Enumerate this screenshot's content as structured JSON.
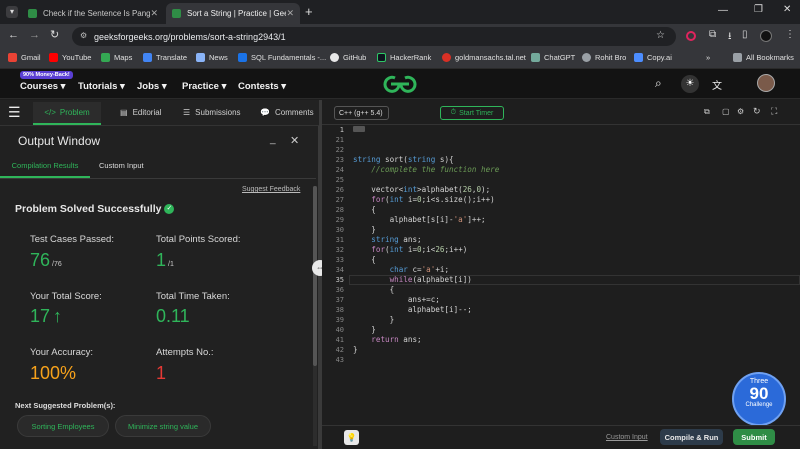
{
  "browser": {
    "tabs": [
      {
        "title": "Check if the Sentence Is Pangra...",
        "active": false
      },
      {
        "title": "Sort a String | Practice | GeeksforG...",
        "active": true
      }
    ],
    "url": "geeksforgeeks.org/problems/sort-a-string2943/1",
    "bookmarks": [
      "Gmail",
      "YouTube",
      "Maps",
      "Translate",
      "News",
      "SQL Fundamentals -...",
      "GitHub",
      "HackerRank",
      "goldmansachs.tal.net",
      "ChatGPT",
      "Rohit Bro",
      "Copy.ai"
    ],
    "all_bookmarks": "All Bookmarks"
  },
  "nav": {
    "promo": "90% Money-Back!",
    "items": [
      "Courses",
      "Tutorials",
      "Jobs",
      "Practice",
      "Contests"
    ],
    "logo": "GG"
  },
  "problem_tabs": [
    "Problem",
    "Editorial",
    "Submissions",
    "Comments"
  ],
  "output": {
    "title": "Output Window",
    "tabs": [
      "Compilation Results",
      "Custom Input"
    ],
    "suggest": "Suggest Feedback",
    "status": "Problem Solved Successfully",
    "tests_label": "Test Cases Passed:",
    "tests_value": "76",
    "tests_total": "/76",
    "points_label": "Total Points Scored:",
    "points_value": "1",
    "points_total": "/1",
    "score_label": "Your Total Score:",
    "score_value": "17",
    "time_label": "Total Time Taken:",
    "time_value": "0.11",
    "accuracy_label": "Your Accuracy:",
    "accuracy_value": "100%",
    "attempts_label": "Attempts No.:",
    "attempts_value": "1",
    "next_label": "Next Suggested Problem(s):",
    "next": [
      "Sorting Employees",
      "Minimize string value"
    ]
  },
  "editor": {
    "language": "C++ (g++ 5.4)",
    "timer": "Start Timer",
    "custom_input": "Custom Input",
    "compile": "Compile & Run",
    "submit": "Submit",
    "badge_top": "Three",
    "badge_num": "90",
    "badge_bottom": "Challenge",
    "line_numbers": [
      "1",
      "21",
      "22",
      "23",
      "24",
      "25",
      "26",
      "27",
      "28",
      "29",
      "30",
      "31",
      "32",
      "33",
      "34",
      "35",
      "36",
      "37",
      "38",
      "39",
      "40",
      "41",
      "42",
      "43"
    ]
  }
}
